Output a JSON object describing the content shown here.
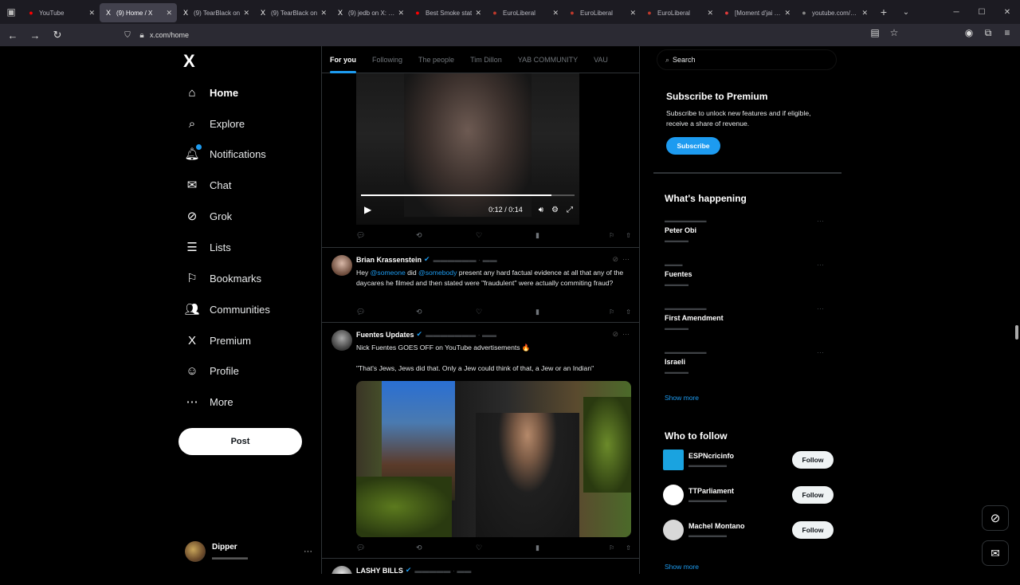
{
  "browser": {
    "tabs": [
      {
        "title": "YouTube",
        "icon": "youtube-icon",
        "color": "#ff0000",
        "active": false
      },
      {
        "title": "(9) Home / X",
        "icon": "x-icon",
        "color": "#ffffff",
        "active": true
      },
      {
        "title": "(9) TearBlack on",
        "icon": "x-icon",
        "color": "#ffffff",
        "active": false
      },
      {
        "title": "(9) TearBlack on",
        "icon": "x-icon",
        "color": "#ffffff",
        "active": false
      },
      {
        "title": "(9) jedb on X: \"Th",
        "icon": "x-icon",
        "color": "#ffffff",
        "active": false
      },
      {
        "title": "Best Smoke stat",
        "icon": "youtube-icon",
        "color": "#ff0000",
        "active": false
      },
      {
        "title": "EuroLiberal",
        "icon": "page-icon",
        "color": "#c0392b",
        "active": false
      },
      {
        "title": "EuroLiberal",
        "icon": "page-icon",
        "color": "#c0392b",
        "active": false
      },
      {
        "title": "EuroLiberal",
        "icon": "page-icon",
        "color": "#c0392b",
        "active": false
      },
      {
        "title": "[Moment d'jai - Gr",
        "icon": "page-icon",
        "color": "#e03b3b",
        "active": false
      },
      {
        "title": "youtube.com/wat",
        "icon": "page-icon",
        "color": "#888888",
        "active": false
      }
    ],
    "url": "x.com/home"
  },
  "sidebar": {
    "logo": "X",
    "items": [
      {
        "label": "Home",
        "icon": "home-icon",
        "glyph": "⌂",
        "active": true
      },
      {
        "label": "Explore",
        "icon": "search-icon",
        "glyph": "⌕",
        "active": false
      },
      {
        "label": "Notifications",
        "icon": "bell-icon",
        "glyph": "🔔︎",
        "active": false
      },
      {
        "label": "Chat",
        "icon": "mail-icon",
        "glyph": "✉",
        "active": false
      },
      {
        "label": "Grok",
        "icon": "grok-icon",
        "glyph": "⊘",
        "active": false
      },
      {
        "label": "Lists",
        "icon": "list-icon",
        "glyph": "☰",
        "active": false
      },
      {
        "label": "Bookmarks",
        "icon": "bookmark-icon",
        "glyph": "⚐",
        "active": false
      },
      {
        "label": "Communities",
        "icon": "communities-icon",
        "glyph": "👥︎",
        "active": false
      },
      {
        "label": "Premium",
        "icon": "x-premium-icon",
        "glyph": "X",
        "active": false
      },
      {
        "label": "Profile",
        "icon": "profile-icon",
        "glyph": "☺",
        "active": false
      },
      {
        "label": "More",
        "icon": "more-icon",
        "glyph": "⋯",
        "active": false
      }
    ],
    "post_label": "Post",
    "account": {
      "name": "Dipper",
      "more": "···"
    }
  },
  "timeline": {
    "tabs": [
      "For you",
      "Following",
      "The people",
      "Tim Dillon",
      "YAB COMMUNITY",
      "VAU"
    ],
    "video1": {
      "time": "0:12 / 0:14",
      "progress": 0.89
    },
    "tweets": [
      {
        "name": "Brian Krassenstein",
        "text_parts": [
          "Hey ",
          "@someone",
          " did ",
          "@somebody",
          " present any hard factual evidence at all that any of the daycares he filmed and then stated were \"fraudulent\" were actually commiting fraud?"
        ]
      },
      {
        "name": "Fuentes Updates",
        "line1": "Nick Fuentes GOES OFF on YouTube advertisements 🔥",
        "line2": "\"That's Jews, Jews did that. Only a Jew could think of that, a Jew or an Indian\""
      },
      {
        "name": "LASHY BILLS"
      }
    ]
  },
  "right": {
    "search_placeholder": "Search",
    "premium": {
      "title": "Subscribe to Premium",
      "text": "Subscribe to unlock new features and if eligible, receive a share of revenue.",
      "button": "Subscribe"
    },
    "happening": {
      "title": "What's happening",
      "trends": [
        "Peter Obi",
        "Fuentes",
        "First Amendment",
        "Israeli"
      ],
      "show_more": "Show more"
    },
    "who_to_follow": {
      "title": "Who to follow",
      "accounts": [
        {
          "name": "ESPNcricinfo",
          "avatar_color": "#1aa3e0"
        },
        {
          "name": "TTParliament",
          "avatar_color": "#ffffff"
        },
        {
          "name": "Machel Montano",
          "avatar_color": "#d8d8d8"
        }
      ],
      "follow_label": "Follow",
      "show_more": "Show more"
    }
  }
}
